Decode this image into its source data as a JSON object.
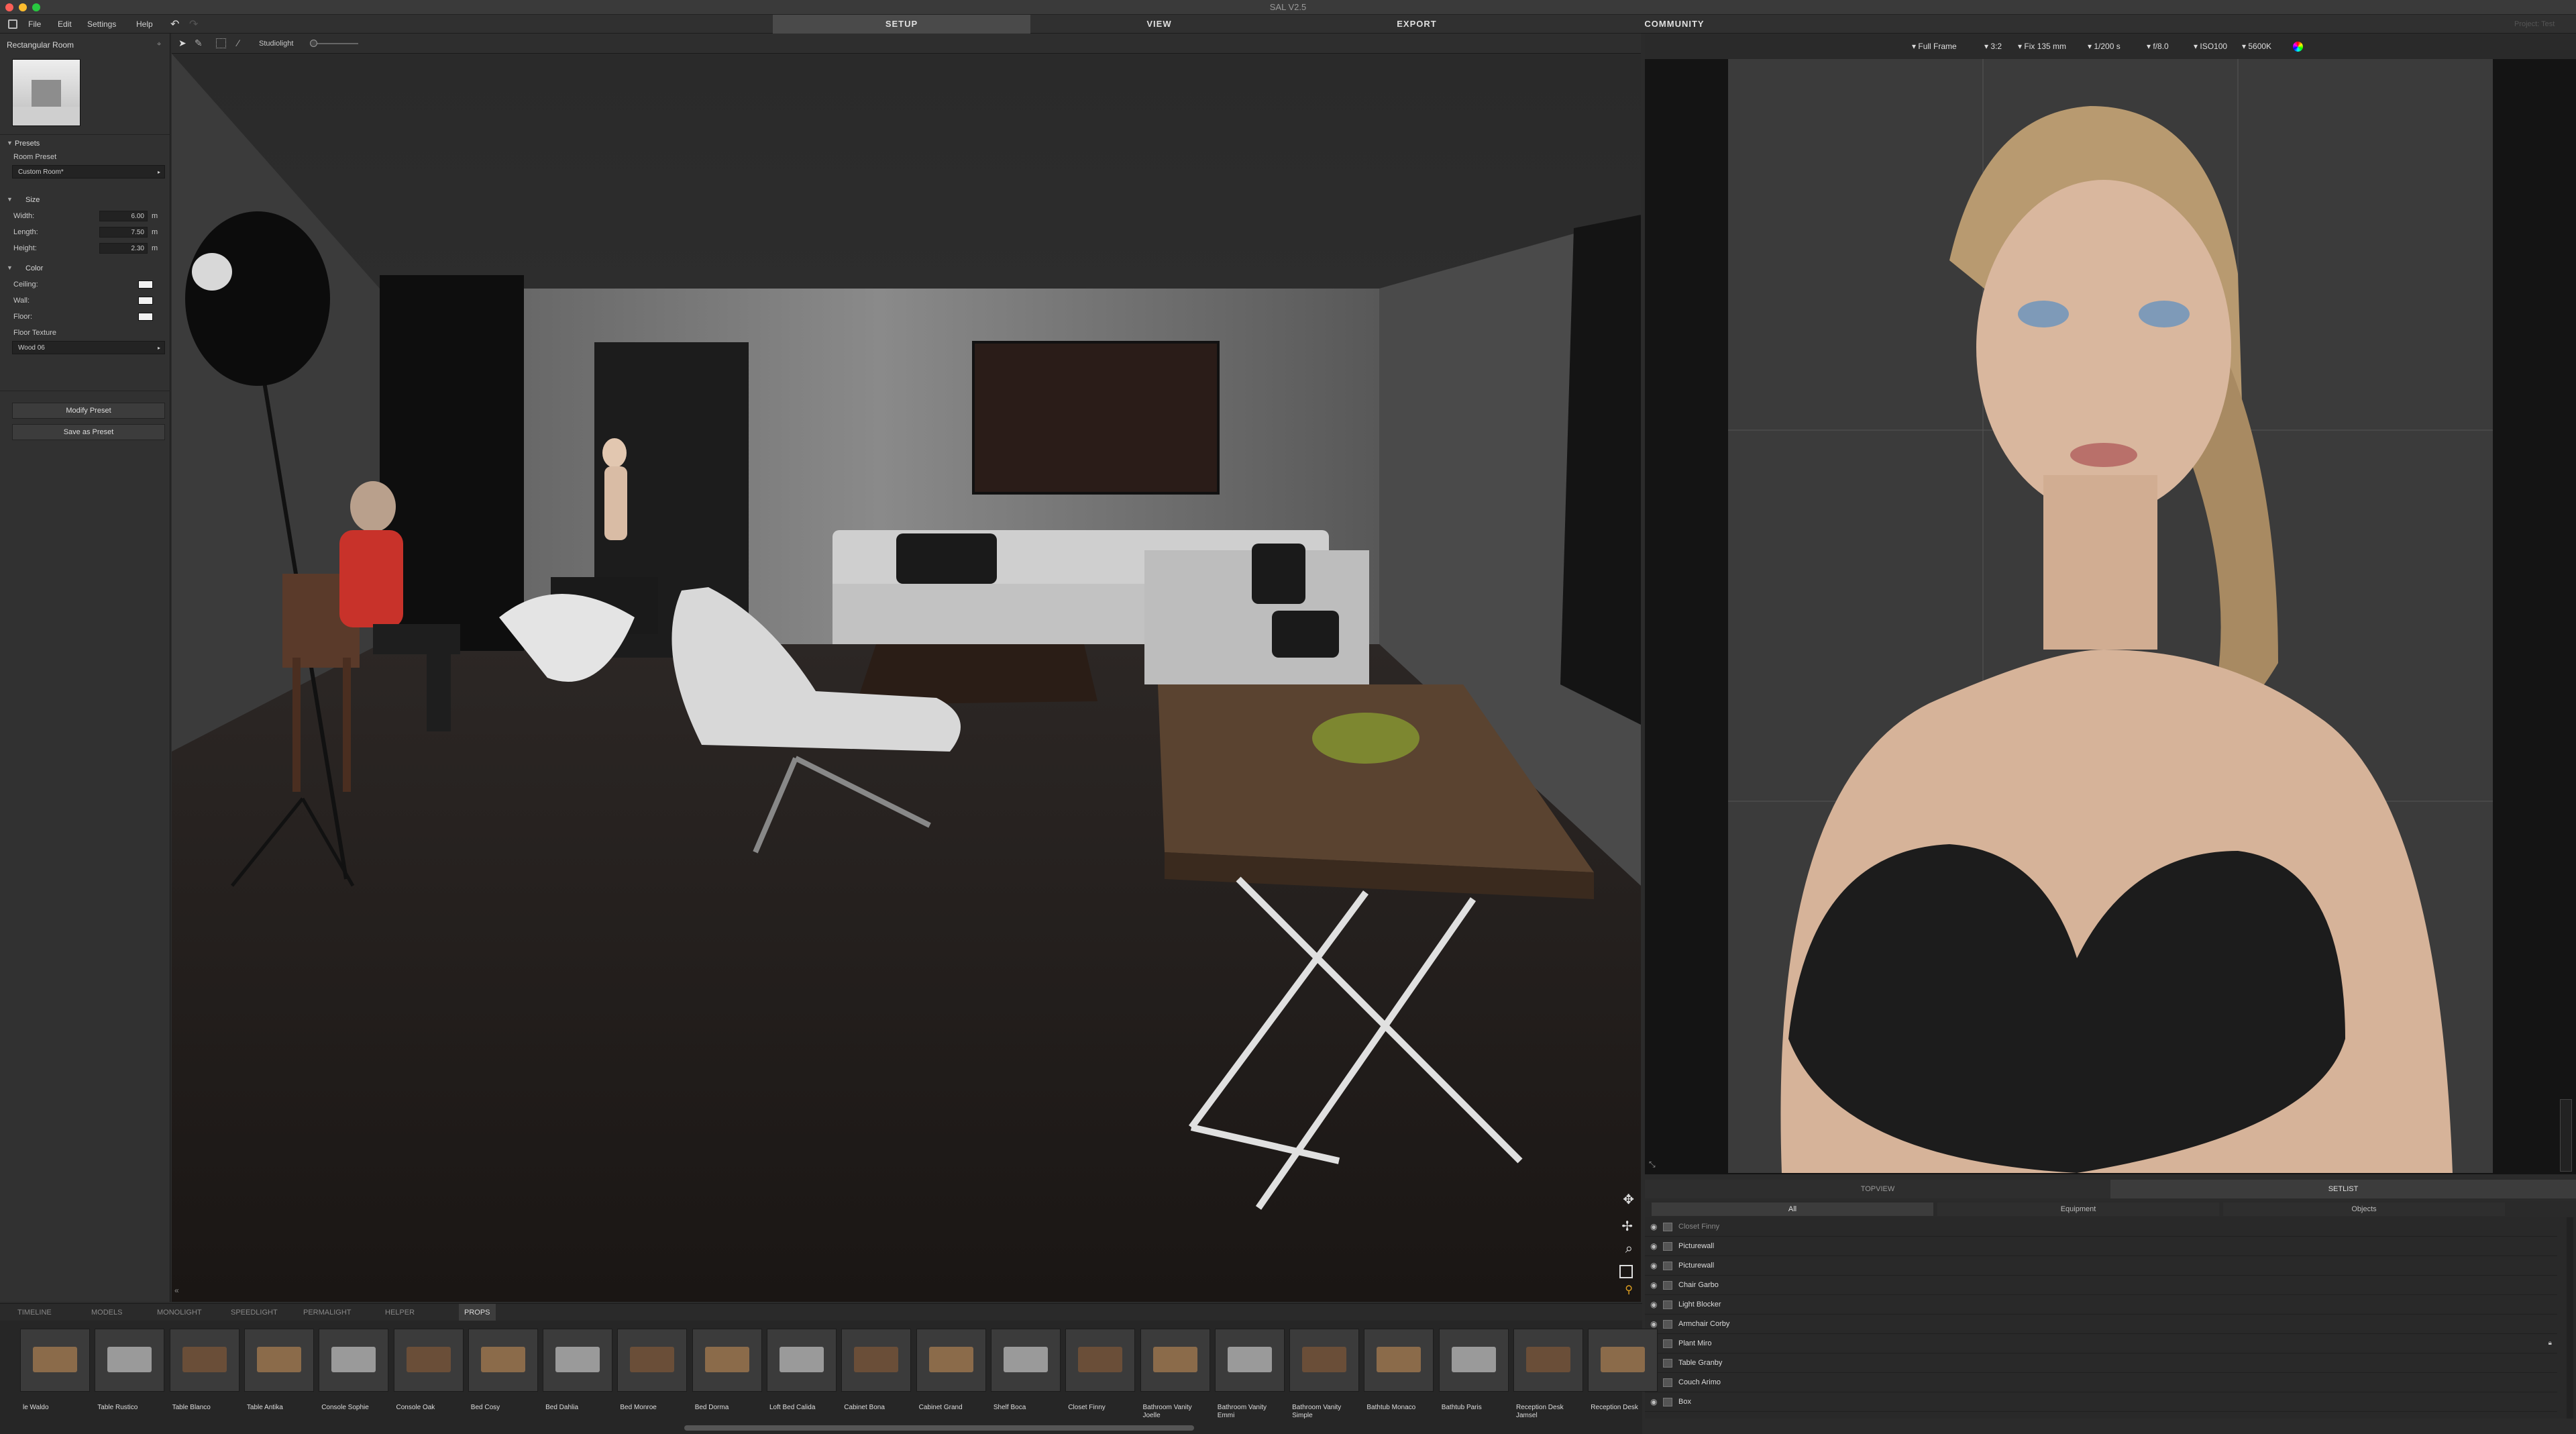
{
  "window": {
    "title": "SAL V2.5"
  },
  "menu": {
    "file": "File",
    "edit": "Edit",
    "settings": "Settings",
    "help": "Help"
  },
  "tabs": {
    "setup": "SETUP",
    "view": "VIEW",
    "export": "EXPORT",
    "community": "COMMUNITY"
  },
  "project": "Project: Test",
  "viewport_toolbar": {
    "studiolight": "Studiolight"
  },
  "left": {
    "room_name": "Rectangular Room",
    "presets_header": "Presets",
    "room_preset_label": "Room Preset",
    "room_preset_value": "Custom Room*",
    "size_header": "Size",
    "width_label": "Width:",
    "width_value": "6.00",
    "width_unit": "m",
    "length_label": "Length:",
    "length_value": "7.50",
    "length_unit": "m",
    "height_label": "Height:",
    "height_value": "2.30",
    "height_unit": "m",
    "color_header": "Color",
    "ceiling_label": "Ceiling:",
    "wall_label": "Wall:",
    "floor_label": "Floor:",
    "floor_texture_label": "Floor Texture",
    "floor_texture_value": "Wood 06",
    "modify_preset": "Modify Preset",
    "save_as_preset": "Save as Preset"
  },
  "camera": {
    "format": "Full Frame",
    "ratio": "3:2",
    "lens": "Fix 135 mm",
    "shutter": "1/200 s",
    "aperture": "f/8.0",
    "iso": "ISO100",
    "wb": "5600K"
  },
  "library_tabs": [
    "TIMELINE",
    "MODELS",
    "MONOLIGHT",
    "SPEEDLIGHT",
    "PERMALIGHT",
    "HELPER",
    "PROPS"
  ],
  "library_items": [
    [
      "le Waldo"
    ],
    [
      "Table Rustico"
    ],
    [
      "Table Blanco"
    ],
    [
      "Table Antika"
    ],
    [
      "Console Sophie"
    ],
    [
      "Console Oak"
    ],
    [
      "Bed Cosy"
    ],
    [
      "Bed Dahlia"
    ],
    [
      "Bed Monroe"
    ],
    [
      "Bed Dorma"
    ],
    [
      "Loft Bed Calida"
    ],
    [
      "Cabinet Bona"
    ],
    [
      "Cabinet Grand"
    ],
    [
      "Shelf Boca"
    ],
    [
      "Closet Finny"
    ],
    [
      "Bathroom Vanity",
      "Joelle"
    ],
    [
      "Bathroom Vanity",
      "Emmi"
    ],
    [
      "Bathroom Vanity",
      "Simple"
    ],
    [
      "Bathtub Monaco"
    ],
    [
      "Bathtub Paris"
    ],
    [
      "Reception Desk",
      "Jamsel"
    ],
    [
      "Reception Desk"
    ]
  ],
  "setlist": {
    "view_tabs": {
      "topview": "TOPVIEW",
      "setlist": "SETLIST"
    },
    "filters": {
      "all": "All",
      "equipment": "Equipment",
      "objects": "Objects"
    },
    "rows": [
      "Closet Finny",
      "Picturewall",
      "Picturewall",
      "Chair Garbo",
      "Light Blocker",
      "Armchair Corby",
      "Plant Miro",
      "Table Granby",
      "Couch Arimo",
      "Box"
    ]
  },
  "colors": {
    "accent_tab": "#4a4a4a",
    "panel": "#313131",
    "viewport_wall": "#7a7a7a",
    "shirt": "#d9362a"
  }
}
